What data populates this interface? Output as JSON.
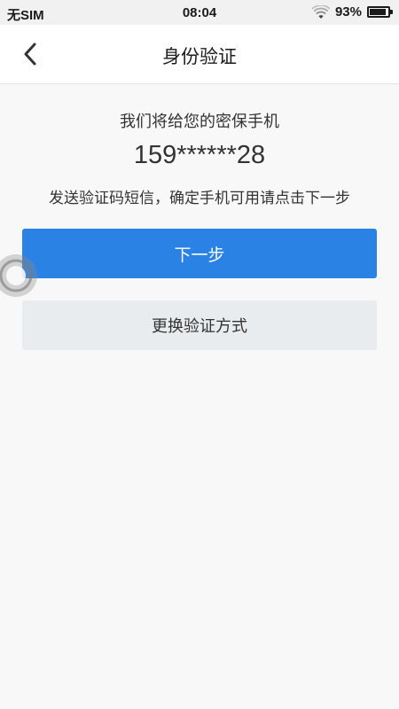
{
  "status_bar": {
    "carrier": "无SIM",
    "time": "08:04",
    "battery_percent": "93%",
    "battery_level": 0.93,
    "icons": {
      "wifi": "wifi-icon",
      "battery": "battery-icon"
    }
  },
  "header": {
    "title": "身份验证",
    "back_icon": "chevron-left-icon"
  },
  "main": {
    "intro": "我们将给您的密保手机",
    "phone_number": "159******28",
    "instruction": "发送验证码短信，确定手机可用请点击下一步",
    "next_button_label": "下一步",
    "switch_method_label": "更换验证方式"
  },
  "overlay": {
    "assistive_icon": "assistive-touch-icon"
  },
  "colors": {
    "primary": "#2a82e4",
    "secondary_button": "#e9ecef",
    "background": "#f8f8f8",
    "header_background": "#ffffff",
    "text": "#333333"
  }
}
